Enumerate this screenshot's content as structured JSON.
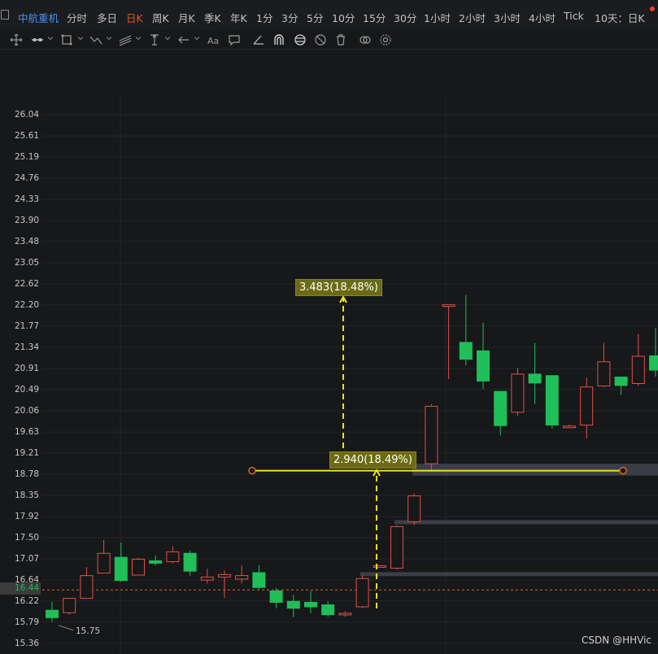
{
  "tabs": {
    "stock_name": "中航重机",
    "items": [
      "分时",
      "多日",
      "日K",
      "周K",
      "月K",
      "季K",
      "年K",
      "1分",
      "3分",
      "5分",
      "10分",
      "15分",
      "30分",
      "1小时",
      "2小时",
      "3小时",
      "4小时",
      "Tick",
      "10天：日K"
    ],
    "active_index": 2
  },
  "toolbar": {
    "tools": [
      "move-icon",
      "line-tool-icon",
      "rectangle-tool-icon",
      "polyline-tool-icon",
      "channel-tool-icon",
      "measure-tool-icon",
      "arrow-tool-icon",
      "text-tool-icon",
      "comment-icon",
      "angle-icon",
      "magnet-icon",
      "sync-icon",
      "hide-icon",
      "delete-icon",
      "link-icon",
      "settings-icon"
    ]
  },
  "axis": {
    "ticks": [
      "26.04",
      "25.61",
      "25.19",
      "24.76",
      "24.33",
      "23.90",
      "23.48",
      "23.05",
      "22.62",
      "22.20",
      "21.77",
      "21.34",
      "20.91",
      "20.49",
      "20.06",
      "19.63",
      "19.21",
      "18.78",
      "18.35",
      "17.92",
      "17.50",
      "17.07",
      "16.64",
      "16.22",
      "15.79",
      "15.36"
    ],
    "last_price": "16.44"
  },
  "annotations": {
    "measure_top": "3.483(18.48%)",
    "measure_mid": "2.940(18.49%)",
    "low_value": "15.75",
    "horizontal_line_price": 18.85
  },
  "colors": {
    "up": "#e0504a",
    "down": "#1fbf5a",
    "measure": "#f0e31a",
    "last_price_line": "#d9692d"
  },
  "watermark": "CSDN @HHVic",
  "chart_data": {
    "type": "candlestick",
    "ylim": [
      15.36,
      26.04
    ],
    "candles": [
      {
        "o": 16.03,
        "h": 16.2,
        "l": 15.79,
        "c": 15.88
      },
      {
        "o": 15.98,
        "h": 16.27,
        "l": 15.94,
        "c": 16.27
      },
      {
        "o": 16.27,
        "h": 16.9,
        "l": 16.27,
        "c": 16.73
      },
      {
        "o": 16.78,
        "h": 17.45,
        "l": 16.78,
        "c": 17.18
      },
      {
        "o": 17.1,
        "h": 17.4,
        "l": 16.61,
        "c": 16.63
      },
      {
        "o": 16.74,
        "h": 17.09,
        "l": 16.74,
        "c": 17.06
      },
      {
        "o": 17.03,
        "h": 17.14,
        "l": 16.93,
        "c": 16.98
      },
      {
        "o": 17.01,
        "h": 17.32,
        "l": 16.98,
        "c": 17.21
      },
      {
        "o": 17.18,
        "h": 17.24,
        "l": 16.73,
        "c": 16.82
      },
      {
        "o": 16.64,
        "h": 16.87,
        "l": 16.57,
        "c": 16.7
      },
      {
        "o": 16.7,
        "h": 16.83,
        "l": 16.28,
        "c": 16.75
      },
      {
        "o": 16.66,
        "h": 16.93,
        "l": 16.57,
        "c": 16.73
      },
      {
        "o": 16.79,
        "h": 16.94,
        "l": 16.45,
        "c": 16.49
      },
      {
        "o": 16.42,
        "h": 16.48,
        "l": 16.07,
        "c": 16.19
      },
      {
        "o": 16.21,
        "h": 16.34,
        "l": 15.89,
        "c": 16.07
      },
      {
        "o": 16.19,
        "h": 16.42,
        "l": 15.97,
        "c": 16.1
      },
      {
        "o": 16.14,
        "h": 16.21,
        "l": 15.9,
        "c": 15.94
      },
      {
        "o": 15.94,
        "h": 16.01,
        "l": 15.9,
        "c": 15.97
      },
      {
        "o": 16.1,
        "h": 16.73,
        "l": 16.07,
        "c": 16.67
      },
      {
        "o": 16.93,
        "h": 16.94,
        "l": 16.93,
        "c": 16.93
      },
      {
        "o": 16.88,
        "h": 17.75,
        "l": 16.85,
        "c": 17.72
      },
      {
        "o": 17.82,
        "h": 18.39,
        "l": 17.75,
        "c": 18.34
      },
      {
        "o": 18.99,
        "h": 20.19,
        "l": 18.86,
        "c": 20.15
      },
      {
        "o": 22.2,
        "h": 22.2,
        "l": 20.7,
        "c": 22.2
      },
      {
        "o": 21.44,
        "h": 22.4,
        "l": 20.98,
        "c": 21.1
      },
      {
        "o": 21.27,
        "h": 21.84,
        "l": 20.5,
        "c": 20.66
      },
      {
        "o": 20.45,
        "h": 20.45,
        "l": 19.56,
        "c": 19.76
      },
      {
        "o": 20.03,
        "h": 20.93,
        "l": 19.96,
        "c": 20.8
      },
      {
        "o": 20.8,
        "h": 21.43,
        "l": 20.2,
        "c": 20.62
      },
      {
        "o": 20.77,
        "h": 20.77,
        "l": 19.7,
        "c": 19.77
      },
      {
        "o": 19.75,
        "h": 19.78,
        "l": 19.74,
        "c": 19.75
      },
      {
        "o": 19.77,
        "h": 20.73,
        "l": 19.5,
        "c": 20.54
      },
      {
        "o": 20.56,
        "h": 21.43,
        "l": 20.54,
        "c": 21.05
      },
      {
        "o": 20.74,
        "h": 20.75,
        "l": 20.38,
        "c": 20.57
      },
      {
        "o": 20.61,
        "h": 21.61,
        "l": 20.56,
        "c": 21.16
      },
      {
        "o": 21.17,
        "h": 21.73,
        "l": 20.75,
        "c": 20.88
      }
    ]
  }
}
